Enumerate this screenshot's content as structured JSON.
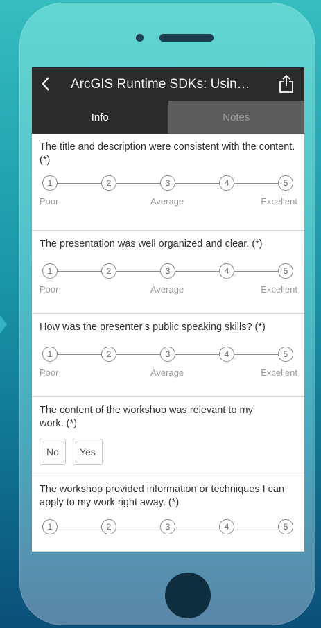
{
  "header": {
    "title": "ArcGIS Runtime SDKs: Usin…",
    "back_icon": "chevron-left-icon",
    "share_icon": "share-icon"
  },
  "tabs": [
    {
      "label": "Info",
      "active": true
    },
    {
      "label": "Notes",
      "active": false
    }
  ],
  "questions": [
    {
      "text": "The title and description were consistent with the content. (*)",
      "scale": [
        "1",
        "2",
        "3",
        "4",
        "5"
      ],
      "labels": {
        "low": "Poor",
        "mid": "Average",
        "high": "Excellent"
      }
    },
    {
      "text": "The presentation was well organized and clear. (*)",
      "scale": [
        "1",
        "2",
        "3",
        "4",
        "5"
      ],
      "labels": {
        "low": "Poor",
        "mid": "Average",
        "high": "Excellent"
      }
    },
    {
      "text": "How was the presenter’s public speaking skills? (*)",
      "scale": [
        "1",
        "2",
        "3",
        "4",
        "5"
      ],
      "labels": {
        "low": "Poor",
        "mid": "Average",
        "high": "Excellent"
      }
    },
    {
      "text": "The content of the workshop was relevant to my work. (*)",
      "options": [
        "No",
        "Yes"
      ]
    },
    {
      "text": "The workshop provided information or techniques I can apply to my work right away. (*)",
      "scale": [
        "1",
        "2",
        "3",
        "4",
        "5"
      ]
    }
  ],
  "colors": {
    "navbar": "#2b2b2b",
    "inactive_tab": "#5c5c5c",
    "background_top": "#35bdbf",
    "background_bottom": "#0b4f78"
  }
}
